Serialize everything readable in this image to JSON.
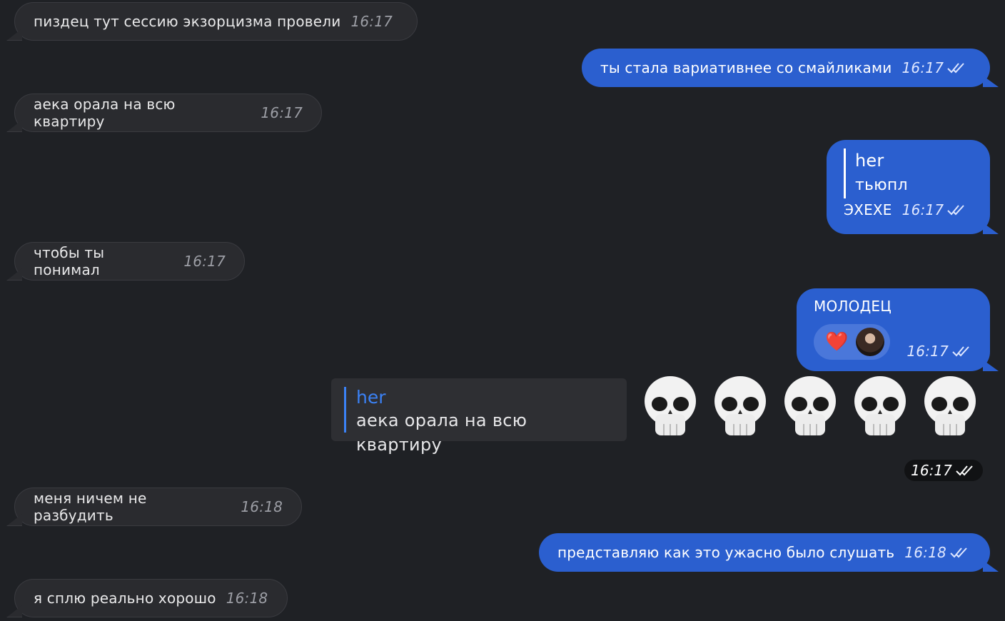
{
  "messages": [
    {
      "id": "m1",
      "dir": "in",
      "text": "пиздец тут сессию экзорцизма провели",
      "time": "16:17"
    },
    {
      "id": "m2",
      "dir": "out",
      "text": "ты стала вариативнее со смайликами",
      "time": "16:17"
    },
    {
      "id": "m3",
      "dir": "in",
      "text": "аека орала на всю квартиру",
      "time": "16:17"
    },
    {
      "id": "m4",
      "dir": "out",
      "reply_name": "her",
      "reply_text": "тьюпл",
      "text": "ЭХЕХЕ",
      "time": "16:17"
    },
    {
      "id": "m5",
      "dir": "in",
      "text": "чтобы ты понимал",
      "time": "16:17"
    },
    {
      "id": "m6",
      "dir": "out",
      "text": "МОЛОДЕЦ",
      "reaction": "❤️",
      "time": "16:17"
    },
    {
      "id": "m7",
      "dir": "out",
      "quote_name": "her",
      "quote_text": "аека орала на всю квартиру",
      "emoji": [
        "💀",
        "💀",
        "💀",
        "💀",
        "💀"
      ],
      "time": "16:17"
    },
    {
      "id": "m8",
      "dir": "in",
      "text": "меня ничем не разбудить",
      "time": "16:18"
    },
    {
      "id": "m9",
      "dir": "out",
      "text": "представляю как это ужасно было слушать",
      "time": "16:18"
    },
    {
      "id": "m10",
      "dir": "in",
      "text": "я сплю реально хорошо",
      "time": "16:18"
    }
  ],
  "colors": {
    "incoming": "#2a2b2f",
    "outgoing": "#2b5fcf",
    "background": "#1f2125",
    "accent": "#3b82f6"
  }
}
